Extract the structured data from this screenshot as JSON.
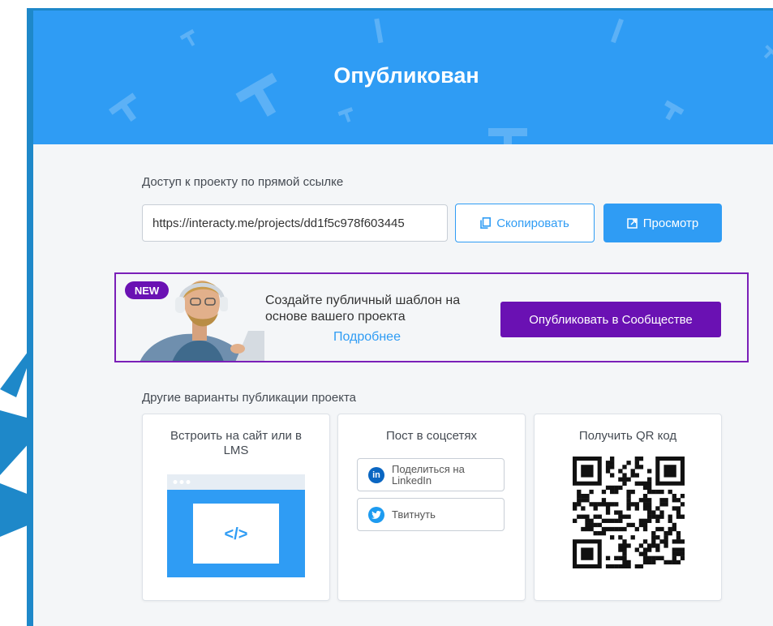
{
  "header": {
    "title": "Опубликован"
  },
  "direct_link": {
    "label": "Доступ к проекту по прямой ссылке",
    "url": "https://interacty.me/projects/dd1f5c978f603445",
    "copy_label": "Скопировать",
    "view_label": "Просмотр"
  },
  "promo": {
    "badge": "NEW",
    "text": "Создайте публичный шаблон на основе вашего проекта",
    "more_link": "Подробнее",
    "cta_label": "Опубликовать в Сообществе"
  },
  "other": {
    "label": "Другие варианты публикации проекта",
    "embed": {
      "title": "Встроить на сайт или в LMS",
      "code_glyph": "</>"
    },
    "social": {
      "title": "Пост в соцсетях",
      "linkedin_label": "Поделиться на LinkedIn",
      "tweet_label": "Твитнуть"
    },
    "qr": {
      "title": "Получить QR код"
    }
  },
  "colors": {
    "brand_blue": "#2f9cf4",
    "purple": "#6a11b3",
    "linkedin": "#0a66c2",
    "twitter": "#1d9bf0"
  }
}
